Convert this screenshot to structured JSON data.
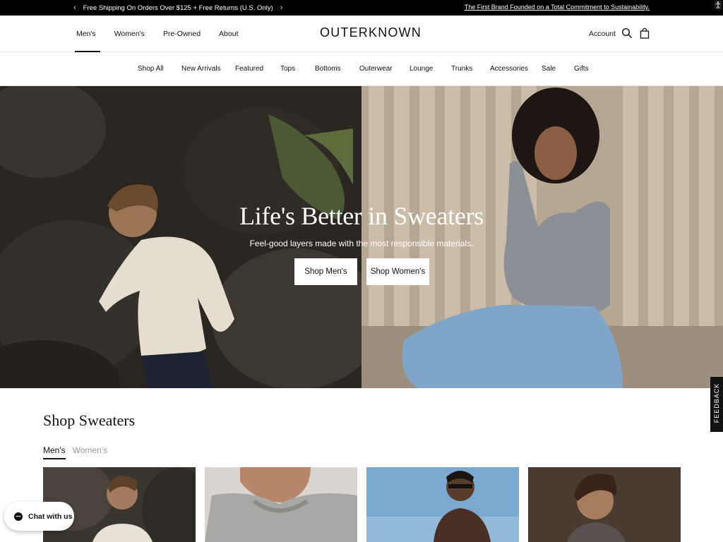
{
  "announcement": {
    "promo_text": "Free Shipping On Orders Over $125 + Free Returns (U.S. Only)",
    "prev_glyph": "‹",
    "next_glyph": "›",
    "mission_text": "The First Brand Founded on a Total Commitment to Sustainability."
  },
  "header": {
    "nav": [
      "Men's",
      "Women's",
      "Pre-Owned",
      "About"
    ],
    "active_nav": "Men's",
    "logo": "OUTERKNOWN",
    "account_label": "Account",
    "icons": [
      "search-icon",
      "bag-icon"
    ]
  },
  "category_nav": [
    "Shop All",
    "New Arrivals",
    "Featured",
    "Tops",
    "Bottoms",
    "Outerwear",
    "Lounge",
    "Trunks",
    "Accessories",
    "Sale",
    "Gifts"
  ],
  "hero": {
    "title": "Life's Better in Sweaters",
    "subtitle": "Feel-good layers made with the most responsible materials.",
    "buttons": [
      "Shop Men's",
      "Shop Women's"
    ]
  },
  "shop_section": {
    "title": "Shop Sweaters",
    "tabs": [
      "Men's",
      "Women's"
    ],
    "active_tab": "Men's"
  },
  "chat": {
    "label": "Chat with us"
  },
  "feedback": {
    "label": "FEEDBACK"
  },
  "colors": {
    "black": "#000000",
    "text": "#111111",
    "muted": "#999999",
    "divider": "#e6e6e6"
  }
}
